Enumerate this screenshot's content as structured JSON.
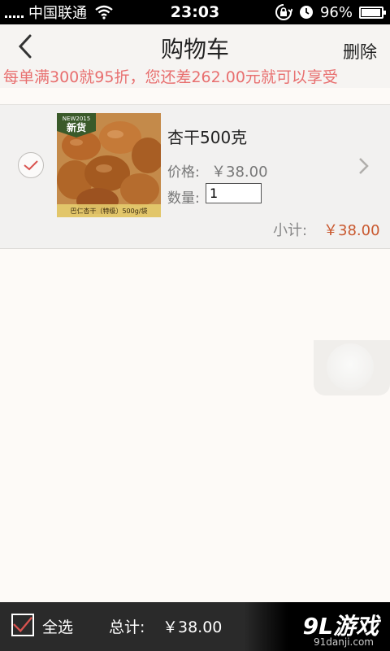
{
  "status_bar": {
    "carrier": "中国联通",
    "time": "23:03",
    "battery_text": "96%",
    "battery_level": 0.96,
    "icons": [
      "signal-icon",
      "wifi-icon",
      "rotation-lock-icon",
      "alarm-icon",
      "battery-icon"
    ]
  },
  "nav": {
    "title": "购物车",
    "delete_label": "删除",
    "back_icon": "chevron-left-icon"
  },
  "promo": {
    "text": "每单满300就95折，您还差262.00元就可以享受"
  },
  "cart": {
    "items": [
      {
        "name": "杏干500克",
        "price_label": "价格:",
        "price_value": "￥38.00",
        "qty_label": "数量:",
        "qty_value": "1",
        "subtotal_label": "小计:",
        "subtotal_value": "￥38.00",
        "checked": true,
        "image_badge_top": "NEW2015",
        "image_badge_main": "新货",
        "image_caption": "巴仁杏干（特级）500g/袋"
      }
    ]
  },
  "bottom": {
    "select_all_label": "全选",
    "total_label": "总计:",
    "total_value": "￥38.00"
  },
  "watermark": {
    "logo": "9L游戏",
    "url": "91danji.com"
  },
  "colors": {
    "promo_text": "#e86f6f",
    "price_accent": "#c9582e",
    "check_mark": "#d9534f",
    "bottom_bar": "#2a2a2a"
  }
}
